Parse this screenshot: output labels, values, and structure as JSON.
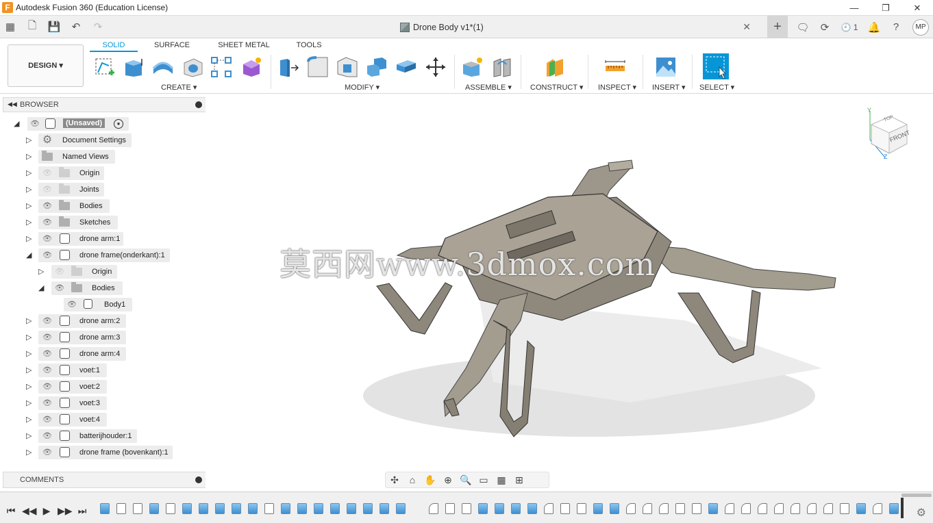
{
  "window": {
    "title": "Autodesk Fusion 360 (Education License)",
    "app_icon_letter": "F",
    "minimize": "—",
    "maximize": "❐",
    "close": "✕"
  },
  "document_tab": {
    "title": "Drone Body v1*(1)",
    "close": "✕"
  },
  "quick_access": {
    "job_status_count": "1",
    "user_initials": "MP"
  },
  "toolbar": {
    "workspace_label": "DESIGN ▾",
    "tabs": [
      {
        "label": "SOLID",
        "active": true
      },
      {
        "label": "SURFACE",
        "active": false
      },
      {
        "label": "SHEET METAL",
        "active": false
      },
      {
        "label": "TOOLS",
        "active": false
      }
    ],
    "groups": {
      "create": "CREATE ▾",
      "modify": "MODIFY ▾",
      "assemble": "ASSEMBLE ▾",
      "construct": "CONSTRUCT ▾",
      "inspect": "INSPECT ▾",
      "insert": "INSERT ▾",
      "select": "SELECT ▾"
    }
  },
  "browser": {
    "title": "BROWSER",
    "items": [
      {
        "label": "(Unsaved)"
      },
      {
        "label": "Document Settings"
      },
      {
        "label": "Named Views"
      },
      {
        "label": "Origin"
      },
      {
        "label": "Joints"
      },
      {
        "label": "Bodies"
      },
      {
        "label": "Sketches"
      },
      {
        "label": "drone arm:1"
      },
      {
        "label": "drone frame(onderkant):1"
      },
      {
        "label": "Origin"
      },
      {
        "label": "Bodies"
      },
      {
        "label": "Body1"
      },
      {
        "label": "drone arm:2"
      },
      {
        "label": "drone arm:3"
      },
      {
        "label": "drone arm:4"
      },
      {
        "label": "voet:1"
      },
      {
        "label": "voet:2"
      },
      {
        "label": "voet:3"
      },
      {
        "label": "voet:4"
      },
      {
        "label": "batterijhouder:1"
      },
      {
        "label": "drone frame (bovenkant):1"
      }
    ]
  },
  "comments": {
    "title": "COMMENTS"
  },
  "viewport": {
    "watermark": "莫西网www.3dmox.com",
    "viewcube_top": "TOP",
    "viewcube_front": "FRONT",
    "axis_y": "Y",
    "axis_z": "Z"
  },
  "colors": {
    "accent": "#0696d7",
    "model_body": "#9a9386",
    "toolbar_bg": "#ffffff",
    "panel_bg": "#f2f2f2"
  }
}
